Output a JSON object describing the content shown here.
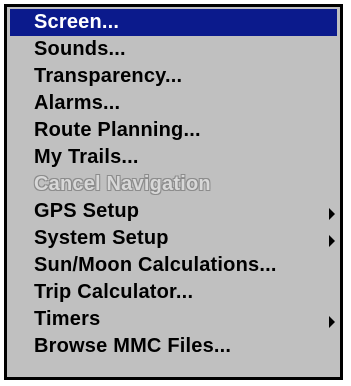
{
  "menu": {
    "items": [
      {
        "label": "Screen...",
        "selected": true
      },
      {
        "label": "Sounds..."
      },
      {
        "label": "Transparency..."
      },
      {
        "label": "Alarms..."
      },
      {
        "label": "Route Planning..."
      },
      {
        "label": "My Trails..."
      },
      {
        "label": "Cancel Navigation",
        "disabled": true
      },
      {
        "label": "GPS Setup",
        "submenu_arrow": "chevron-right-icon"
      },
      {
        "label": "System Setup",
        "submenu_arrow": "chevron-right-icon"
      },
      {
        "label": "Sun/Moon Calculations..."
      },
      {
        "label": "Trip Calculator..."
      },
      {
        "label": "Timers",
        "submenu_arrow": "chevron-right-icon"
      },
      {
        "label": "Browse MMC Files..."
      }
    ],
    "colors": {
      "background": "#c0c0c0",
      "selection": "#0b1a8c",
      "selected_text": "#ffffff",
      "text": "#000000",
      "disabled_text": "#d8d8d8"
    }
  }
}
